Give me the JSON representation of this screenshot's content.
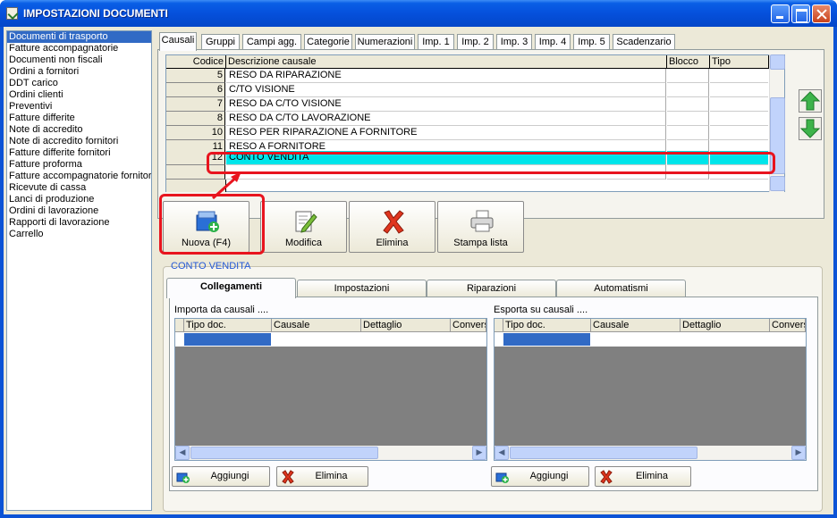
{
  "window": {
    "title": "IMPOSTAZIONI DOCUMENTI"
  },
  "documents": [
    "Documenti di trasporto",
    "Fatture accompagnatorie",
    "Documenti non fiscali",
    "Ordini a fornitori",
    "DDT carico",
    "Ordini clienti",
    "Preventivi",
    "Fatture differite",
    "Note di accredito",
    "Note di accredito fornitori",
    "Fatture differite fornitori",
    "Fatture proforma",
    "Fatture accompagnatorie fornitori",
    "Ricevute di cassa",
    "Lanci di produzione",
    "Ordini di lavorazione",
    "Rapporti di lavorazione",
    "Carrello"
  ],
  "tabs": [
    "Causali",
    "Gruppi",
    "Campi agg.",
    "Categorie",
    "Numerazioni",
    "Imp. 1",
    "Imp. 2",
    "Imp. 3",
    "Imp. 4",
    "Imp. 5",
    "Scadenzario"
  ],
  "grid": {
    "headers": {
      "code": "Codice",
      "desc": "Descrizione causale",
      "blocco": "Blocco",
      "tipo": "Tipo"
    },
    "rows": [
      {
        "code": "5",
        "desc": "RESO DA RIPARAZIONE"
      },
      {
        "code": "6",
        "desc": "C/TO VISIONE"
      },
      {
        "code": "7",
        "desc": "RESO DA C/TO VISIONE"
      },
      {
        "code": "8",
        "desc": "RESO DA C/TO LAVORAZIONE"
      },
      {
        "code": "10",
        "desc": "RESO PER RIPARAZIONE A FORNITORE"
      },
      {
        "code": "11",
        "desc": "RESO A FORNITORE"
      },
      {
        "code": "12",
        "desc": "CONTO VENDITA"
      }
    ]
  },
  "actions": {
    "new": "Nuova (F4)",
    "edit": "Modifica",
    "delete": "Elimina",
    "print": "Stampa lista"
  },
  "detail": {
    "title": "CONTO VENDITA",
    "tabs": [
      "Collegamenti",
      "Impostazioni",
      "Riparazioni",
      "Automatismi"
    ],
    "import": {
      "label": "Importa da causali ....",
      "cols": [
        "Tipo doc.",
        "Causale",
        "Dettaglio",
        "Convers"
      ]
    },
    "export": {
      "label": "Esporta su causali ....",
      "cols": [
        "Tipo doc.",
        "Causale",
        "Dettaglio",
        "Conversi"
      ]
    },
    "add": "Aggiungi",
    "remove": "Elimina"
  },
  "colors": {
    "selection": "#00e5ea",
    "highlight": "#e8141e",
    "titlebar": "#0550dc"
  }
}
